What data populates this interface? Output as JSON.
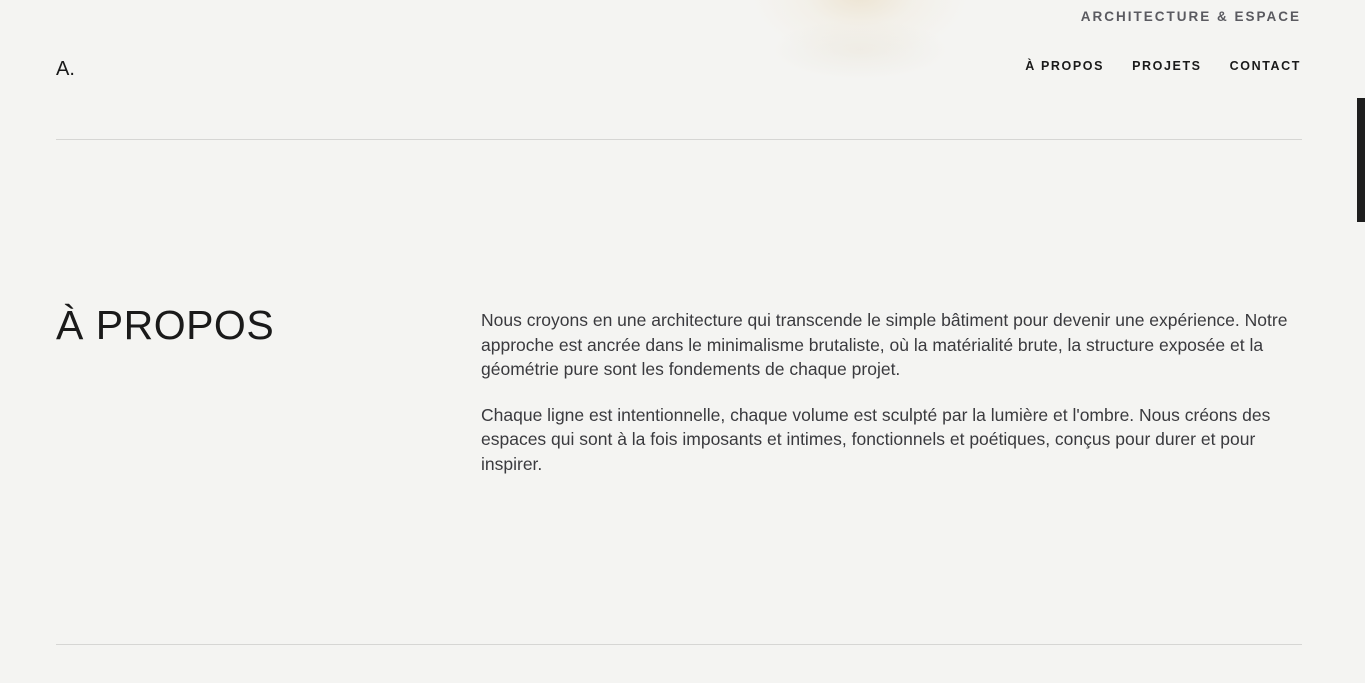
{
  "header": {
    "tagline": "ARCHITECTURE & ESPACE",
    "logo": "A.",
    "nav": [
      {
        "label": "À PROPOS"
      },
      {
        "label": "PROJETS"
      },
      {
        "label": "CONTACT"
      }
    ]
  },
  "about": {
    "title": "À PROPOS",
    "paragraphs": [
      "Nous croyons en une architecture qui transcende le simple bâtiment pour devenir une expérience. Notre approche est ancrée dans le minimalisme brutaliste, où la matérialité brute, la structure exposée et la géométrie pure sont les fondements de chaque projet.",
      "Chaque ligne est intentionnelle, chaque volume est sculpté par la lumière et l'ombre. Nous créons des espaces qui sont à la fois imposants et intimes, fonctionnels et poétiques, conçus pour durer et pour inspirer."
    ]
  },
  "colors": {
    "background": "#f4f4f2",
    "text": "#1a1a1a",
    "muted": "#5a5a60",
    "divider": "#d6d6d4"
  }
}
